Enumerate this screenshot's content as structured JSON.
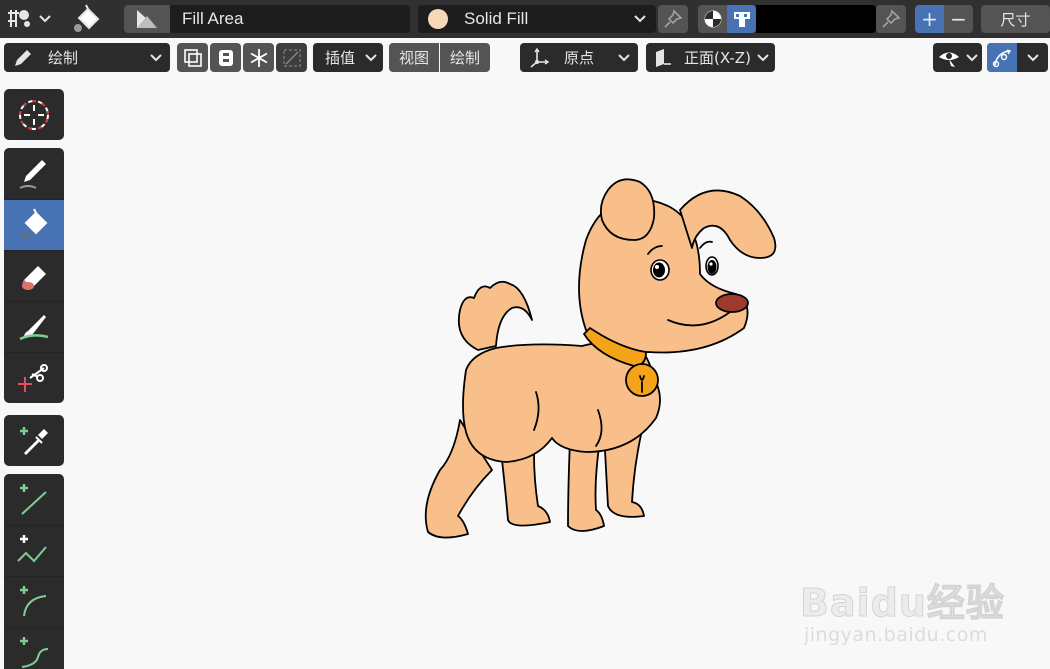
{
  "header": {
    "mode_icon": "grease-pencil-mode-icon",
    "active_tool_icon": "paint-bucket-icon",
    "fill_material": "Fill Area",
    "fill_style": "Solid Fill",
    "fill_swatch_color": "#f6d7b8",
    "vertex_color": "#000000",
    "size_label": "尺寸",
    "add_label": "+",
    "remove_label": "−"
  },
  "toolheader": {
    "draw_mode": "绘制",
    "interpolate_label": "插值",
    "view_label": "视图",
    "draw_label": "绘制",
    "origin_label": "原点",
    "plane_label": "正面(X-Z)"
  },
  "toolbar": {
    "tools": [
      {
        "name": "cursor-tool",
        "icon": "cursor-crosshair-icon"
      },
      {
        "name": "draw-tool",
        "icon": "pencil-icon"
      },
      {
        "name": "fill-tool",
        "icon": "paint-bucket-icon",
        "active": true
      },
      {
        "name": "erase-tool",
        "icon": "eraser-icon"
      },
      {
        "name": "tint-tool",
        "icon": "brush-icon"
      },
      {
        "name": "cutter-tool",
        "icon": "scissors-icon"
      },
      {
        "name": "eyedropper-tool",
        "icon": "eyedropper-icon"
      },
      {
        "name": "line-tool",
        "icon": "line-icon"
      },
      {
        "name": "polyline-tool",
        "icon": "polyline-icon"
      },
      {
        "name": "arc-tool",
        "icon": "arc-icon"
      },
      {
        "name": "curve-tool",
        "icon": "curve-icon"
      }
    ]
  },
  "colors": {
    "accent": "#4772b3",
    "dog_body": "#f9bf8b",
    "dog_collar": "#f5a31a",
    "dog_nose": "#9c3a2e",
    "outline": "#000000"
  },
  "watermark": {
    "brand": "Baidu经验",
    "url": "jingyan.baidu.com"
  }
}
